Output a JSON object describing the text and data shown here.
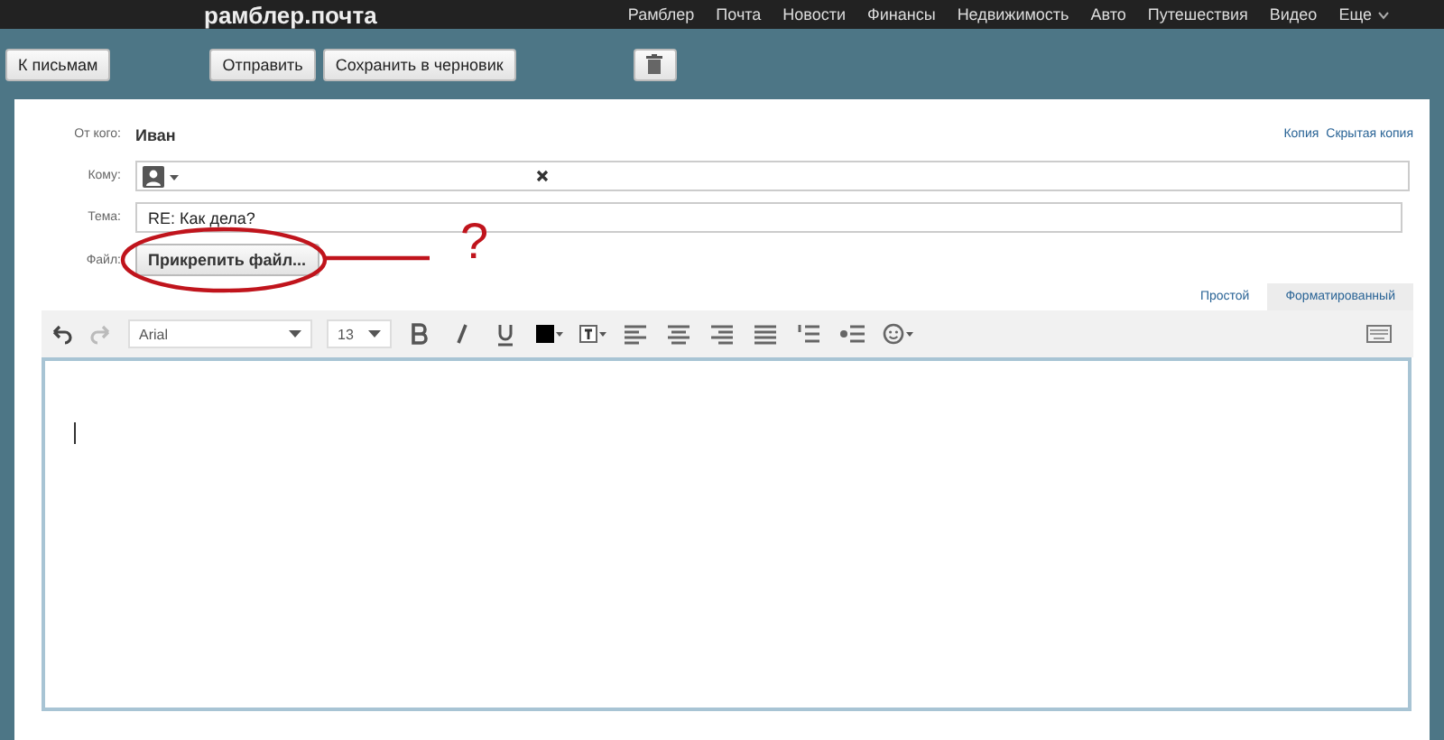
{
  "header": {
    "logo": "рамблер.почта",
    "nav": [
      {
        "label": "Рамблер"
      },
      {
        "label": "Почта"
      },
      {
        "label": "Новости"
      },
      {
        "label": "Финансы"
      },
      {
        "label": "Недвижимость"
      },
      {
        "label": "Авто"
      },
      {
        "label": "Путешествия"
      },
      {
        "label": "Видео"
      },
      {
        "label": "Еще",
        "kind": "more"
      }
    ]
  },
  "toolbar": {
    "back": "К письмам",
    "actions": [
      {
        "label": "Отправить"
      },
      {
        "label": "Сохранить в черновик"
      }
    ]
  },
  "form": {
    "from_label": "От кого:",
    "from_value": "Иван",
    "copy_links": [
      {
        "label": "Копия"
      },
      {
        "label": "Скрытая копия"
      }
    ],
    "to_label": "Кому:",
    "subject_label": "Тема:",
    "subject_value": "RE: Как дела?",
    "file_label": "Файл:",
    "attach_button": "Прикрепить файл..."
  },
  "annotation": {
    "mark": "?"
  },
  "mode_tabs": [
    {
      "label": "Простой",
      "selected": false
    },
    {
      "label": "Форматированный",
      "selected": true
    }
  ],
  "editor": {
    "undo_disabled": false,
    "redo_disabled": true,
    "font": "Arial",
    "size": "13"
  }
}
